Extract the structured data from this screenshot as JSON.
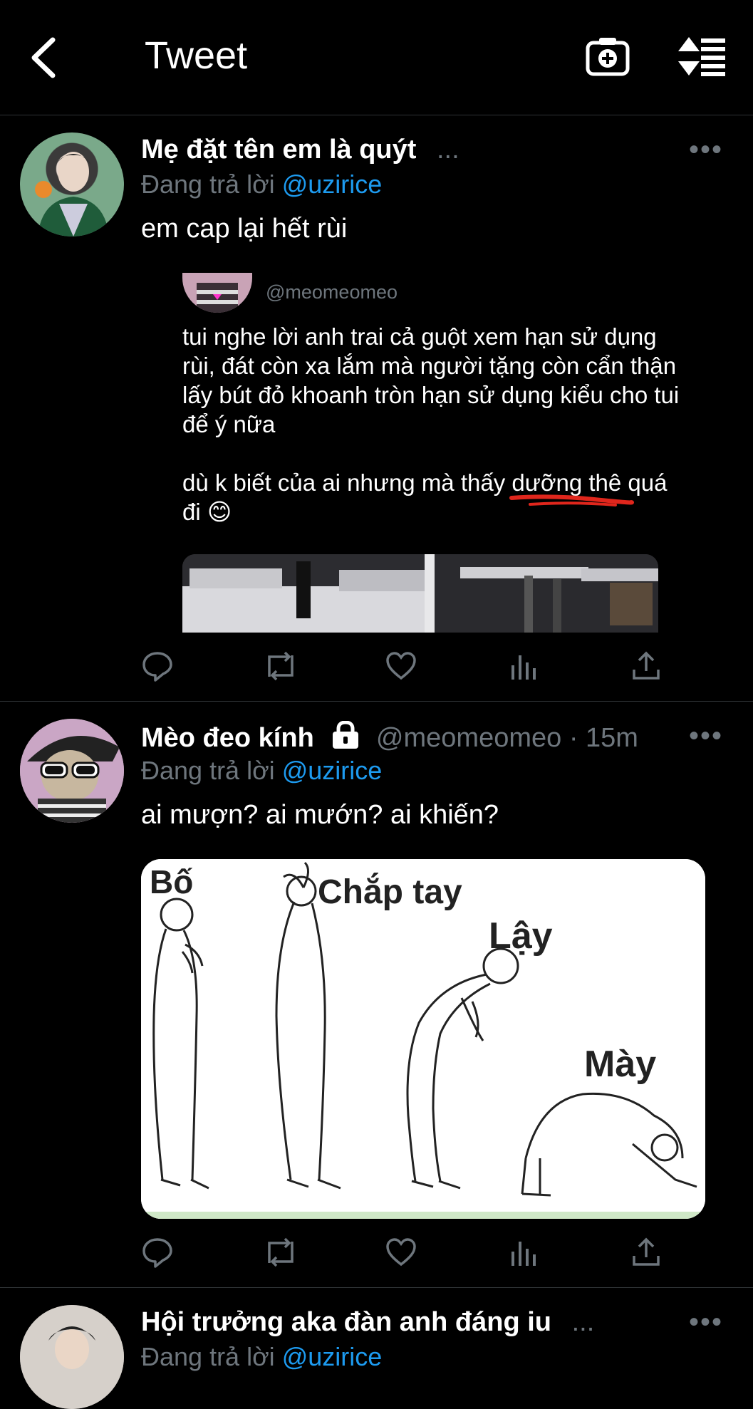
{
  "header": {
    "title": "Tweet",
    "back_icon": "chevron-left-icon",
    "camera_icon": "camera-plus-icon",
    "sort_icon": "sort-list-icon"
  },
  "tweets": [
    {
      "name": "Mẹ đặt tên em là quýt",
      "ellipsis": "...",
      "meta": "",
      "more": "•••",
      "reply_prefix": "Đang trả lời",
      "reply_handle": "@uzirice",
      "text": "em cap lại hết rùi",
      "quote": {
        "handle": "@meomeomeo",
        "paragraph1": "tui nghe lời anh trai cả guột xem hạn sử dụng rùi, đát còn xa lắm mà người tặng còn cẩn thận lấy bút đỏ khoanh tròn hạn sử dụng kiểu cho tui để ý nữa",
        "paragraph2_start": "dù k biết của ai nhưng mà thấy ",
        "paragraph2_underlined": "dưỡng thê",
        "paragraph2_end": " quá đi 😊"
      }
    },
    {
      "name": "Mèo đeo kính",
      "lock_icon": "lock-icon",
      "meta": "@meomeomeo · 15m",
      "more": "•••",
      "reply_prefix": "Đang trả lời",
      "reply_handle": "@uzirice",
      "text": "ai mượn? ai mướn? ai khiến?",
      "image_labels": [
        "Bố",
        "Chắp tay",
        "Lậy",
        "Mày"
      ]
    },
    {
      "name": "Hội trưởng aka đàn anh đáng iu",
      "ellipsis": "...",
      "more": "•••",
      "reply_prefix": "Đang trả lời",
      "reply_handle": "@uzirice"
    }
  ],
  "colors": {
    "background": "#000000",
    "link": "#1d9bf0",
    "muted": "#6e767d",
    "text": "#ffffff",
    "underline": "#e0261c"
  }
}
